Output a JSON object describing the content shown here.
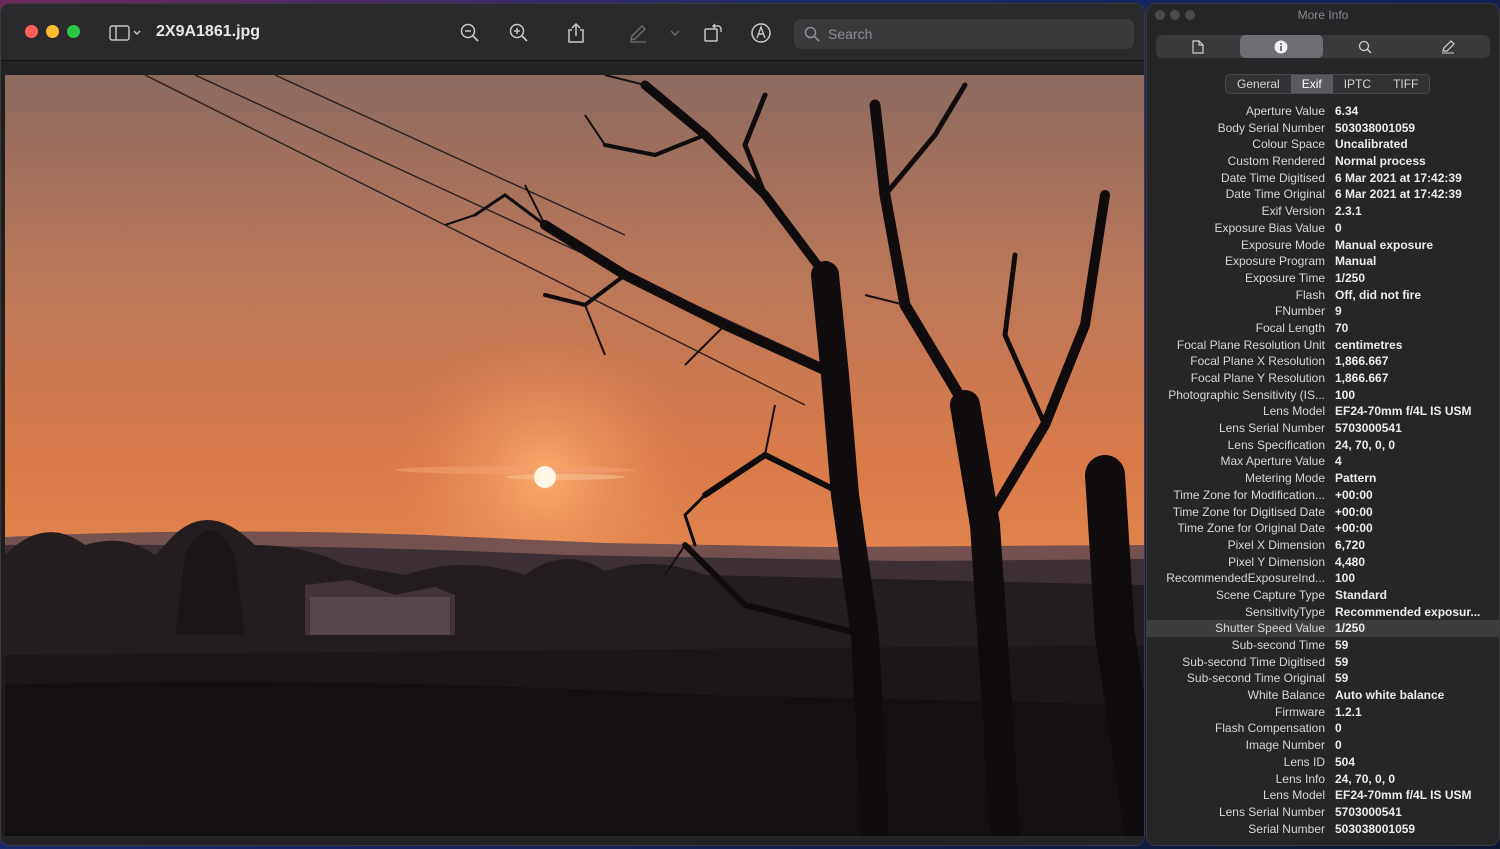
{
  "window": {
    "title": "2X9A1861.jpg",
    "search_placeholder": "Search"
  },
  "inspector": {
    "title": "More Info",
    "tabs": [
      "General",
      "Exif",
      "IPTC",
      "TIFF"
    ],
    "active_tab": "Exif",
    "rows": [
      {
        "key": "Aperture Value",
        "value": "6.34"
      },
      {
        "key": "Body Serial Number",
        "value": "503038001059"
      },
      {
        "key": "Colour Space",
        "value": "Uncalibrated"
      },
      {
        "key": "Custom Rendered",
        "value": "Normal process"
      },
      {
        "key": "Date Time Digitised",
        "value": "6 Mar 2021 at 17:42:39"
      },
      {
        "key": "Date Time Original",
        "value": "6 Mar 2021 at 17:42:39"
      },
      {
        "key": "Exif Version",
        "value": "2.3.1"
      },
      {
        "key": "Exposure Bias Value",
        "value": "0"
      },
      {
        "key": "Exposure Mode",
        "value": "Manual exposure"
      },
      {
        "key": "Exposure Program",
        "value": "Manual"
      },
      {
        "key": "Exposure Time",
        "value": "1/250"
      },
      {
        "key": "Flash",
        "value": "Off, did not fire"
      },
      {
        "key": "FNumber",
        "value": "9"
      },
      {
        "key": "Focal Length",
        "value": "70"
      },
      {
        "key": "Focal Plane Resolution Unit",
        "value": "centimetres"
      },
      {
        "key": "Focal Plane X Resolution",
        "value": "1,866.667"
      },
      {
        "key": "Focal Plane Y Resolution",
        "value": "1,866.667"
      },
      {
        "key": "Photographic Sensitivity (IS...",
        "value": "100"
      },
      {
        "key": "Lens Model",
        "value": "EF24-70mm f/4L IS USM"
      },
      {
        "key": "Lens Serial Number",
        "value": "5703000541"
      },
      {
        "key": "Lens Specification",
        "value": "24, 70, 0, 0"
      },
      {
        "key": "Max Aperture Value",
        "value": "4"
      },
      {
        "key": "Metering Mode",
        "value": "Pattern"
      },
      {
        "key": "Time Zone for Modification...",
        "value": "+00:00"
      },
      {
        "key": "Time Zone for Digitised Date",
        "value": "+00:00"
      },
      {
        "key": "Time Zone for Original Date",
        "value": "+00:00"
      },
      {
        "key": "Pixel X Dimension",
        "value": "6,720"
      },
      {
        "key": "Pixel Y Dimension",
        "value": "4,480"
      },
      {
        "key": "RecommendedExposureInd...",
        "value": "100"
      },
      {
        "key": "Scene Capture Type",
        "value": "Standard"
      },
      {
        "key": "SensitivityType",
        "value": "Recommended exposur..."
      },
      {
        "key": "Shutter Speed Value",
        "value": "1/250",
        "selected": true
      },
      {
        "key": "Sub-second Time",
        "value": "59"
      },
      {
        "key": "Sub-second Time Digitised",
        "value": "59"
      },
      {
        "key": "Sub-second Time Original",
        "value": "59"
      },
      {
        "key": "White Balance",
        "value": "Auto white balance"
      },
      {
        "key": "Firmware",
        "value": "1.2.1"
      },
      {
        "key": "Flash Compensation",
        "value": "0"
      },
      {
        "key": "Image Number",
        "value": "0"
      },
      {
        "key": "Lens ID",
        "value": "504"
      },
      {
        "key": "Lens Info",
        "value": "24, 70, 0, 0"
      },
      {
        "key": "Lens Model",
        "value": "EF24-70mm f/4L IS USM"
      },
      {
        "key": "Lens Serial Number",
        "value": "5703000541"
      },
      {
        "key": "Serial Number",
        "value": "503038001059"
      }
    ]
  },
  "colors": {
    "close": "#ff5f57",
    "minimize": "#febc2e",
    "zoom": "#28c840",
    "sky_top": "#a07060",
    "sky_mid": "#e07a48",
    "sun": "#fff4e0"
  }
}
